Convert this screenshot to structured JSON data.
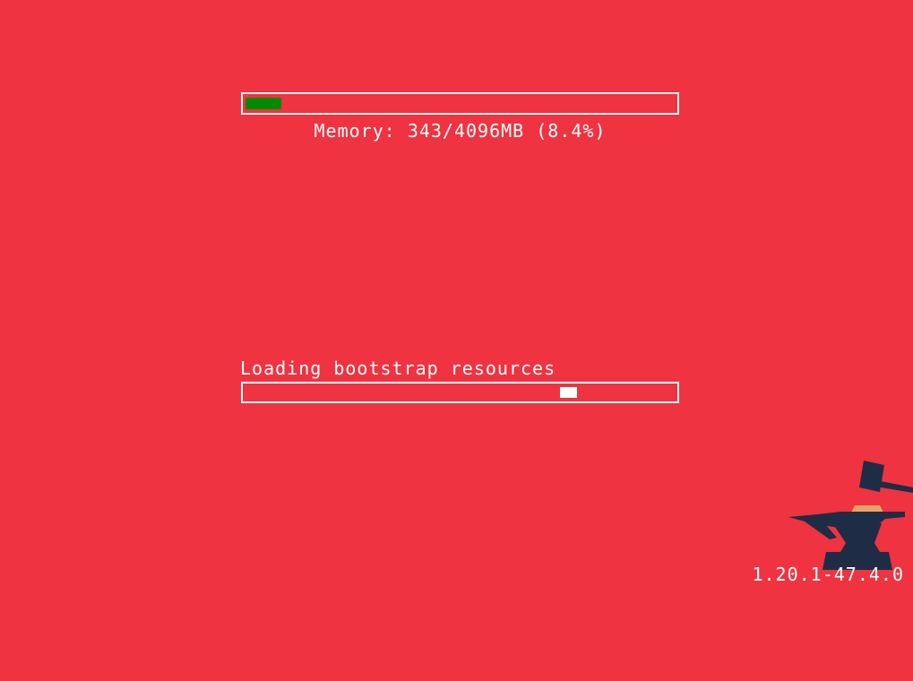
{
  "memory": {
    "label": "Memory: 343/4096MB (8.4%)",
    "used_mb": 343,
    "total_mb": 4096,
    "percent": 8.4,
    "bar_fill_color": "#008a00",
    "bar_border_color": "#ffffff"
  },
  "loading": {
    "label": "Loading bootstrap resources",
    "indicator_position_fraction": 0.76,
    "indicator_color": "#ffffff"
  },
  "version": "1.20.1-47.4.0",
  "logo": {
    "icon": "anvil-hammer-icon",
    "anvil_color": "#1e2d45",
    "accent_color": "#e8a367"
  },
  "background_color": "#ef3340"
}
